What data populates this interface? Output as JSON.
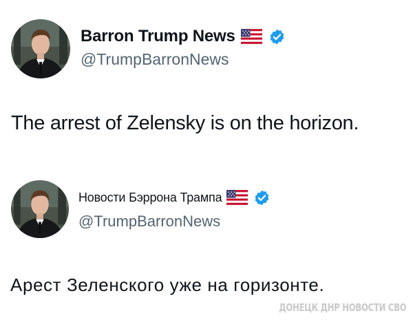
{
  "posts": [
    {
      "display_name": "Barron Trump News",
      "flag_icon": "us-flag-icon",
      "verified_icon": "verified-badge-icon",
      "handle": "@TrumpBarronNews",
      "text": "The arrest of Zelensky is on the horizon."
    },
    {
      "display_name": "Новости Бэррона Трампа",
      "flag_icon": "us-flag-icon",
      "verified_icon": "verified-badge-icon",
      "handle": "@TrumpBarronNews",
      "text": "Арест Зеленского уже на горизонте."
    }
  ],
  "watermark": "ДОНЕЦК ДНР НОВОСТИ СВО",
  "colors": {
    "verified_blue": "#1d9bf0",
    "handle_gray": "#536471",
    "text": "#0f1419",
    "watermark": "#c9c9c9"
  }
}
